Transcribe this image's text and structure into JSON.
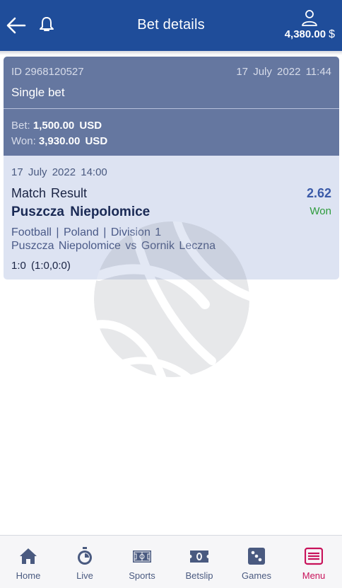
{
  "header": {
    "title": "Bet details",
    "balance_amount": "4,380.00",
    "balance_currency": "$"
  },
  "bet": {
    "id_text": "ID 2968120527",
    "placed_date": "17 July 2022 11:44",
    "type": "Single bet",
    "stake_label": "Bet:",
    "stake_value": "1,500.00 USD",
    "won_label": "Won:",
    "won_value": "3,930.00 USD"
  },
  "event": {
    "date": "17 July 2022 14:00",
    "market": "Match Result",
    "odds": "2.62",
    "selection": "Puszcza Niepolomice",
    "status": "Won",
    "league": "Football | Poland | Division 1",
    "teams": "Puszcza Niepolomice vs Gornik Leczna",
    "score": "1:0 (1:0,0:0)"
  },
  "nav": {
    "items": [
      {
        "label": "Home",
        "icon": "home-icon"
      },
      {
        "label": "Live",
        "icon": "stopwatch-icon"
      },
      {
        "label": "Sports",
        "icon": "field-icon"
      },
      {
        "label": "Betslip",
        "icon": "ticket-icon"
      },
      {
        "label": "Games",
        "icon": "dice-icon"
      },
      {
        "label": "Menu",
        "icon": "menu-icon"
      }
    ],
    "active": "Menu"
  },
  "colors": {
    "header_bg": "#1f4d9a",
    "card_header_bg": "#6577a0",
    "card_body_bg": "#dde3f2",
    "won_green": "#2d9b3c",
    "odds_blue": "#3a5aa8",
    "menu_active": "#c8125a"
  }
}
